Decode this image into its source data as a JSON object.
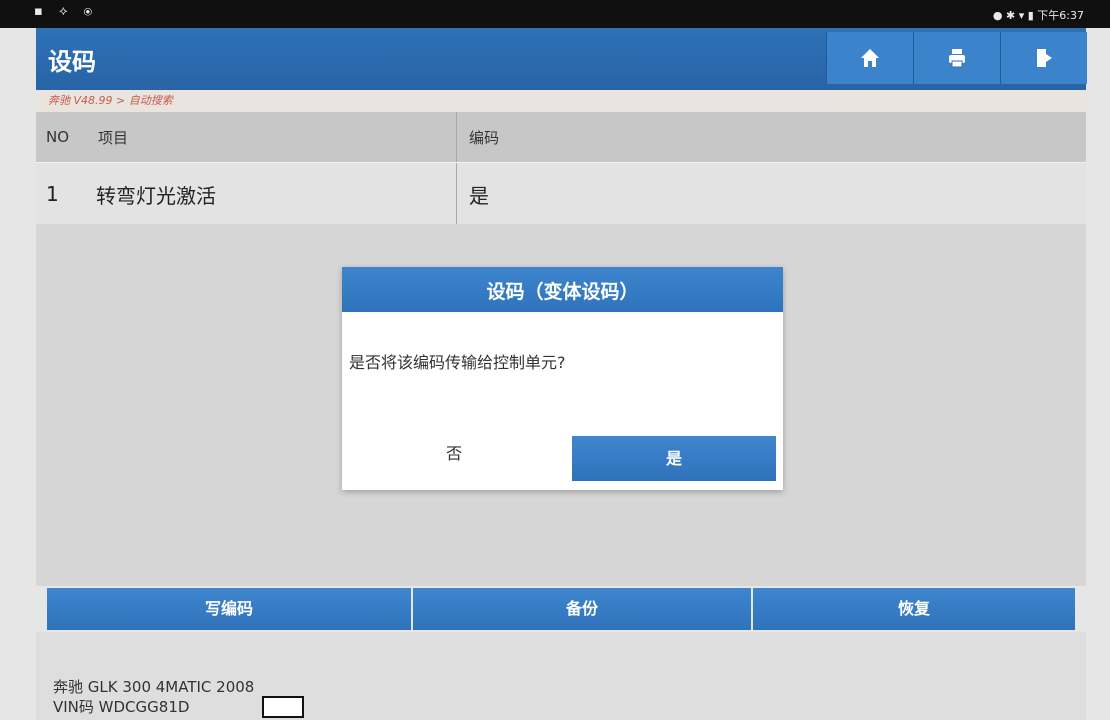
{
  "statusbar": {
    "left_icons": "▪ ⟡ ⦿",
    "right": "● ✱ ▾ ▮ 下午6:37"
  },
  "header": {
    "title": "设码",
    "icons": [
      "home-icon",
      "print-icon",
      "exit-icon"
    ]
  },
  "breadcrumb": "奔驰 V48.99 > 自动搜索",
  "table": {
    "headers": {
      "no": "NO",
      "item": "项目",
      "code": "编码"
    },
    "rows": [
      {
        "no": "1",
        "item": "转弯灯光激活",
        "code": "是"
      }
    ]
  },
  "dialog": {
    "title": "设码（变体设码）",
    "message": "是否将该编码传输给控制单元?",
    "no_label": "否",
    "yes_label": "是"
  },
  "actions": {
    "write": "写编码",
    "backup": "备份",
    "restore": "恢复"
  },
  "vehicle": {
    "model": "奔驰 GLK 300 4MATIC 2008",
    "vin": "VIN码 WDCGG81D"
  },
  "colors": {
    "accent": "#2e71b6",
    "breadcrumb_text": "#c85b4d"
  }
}
